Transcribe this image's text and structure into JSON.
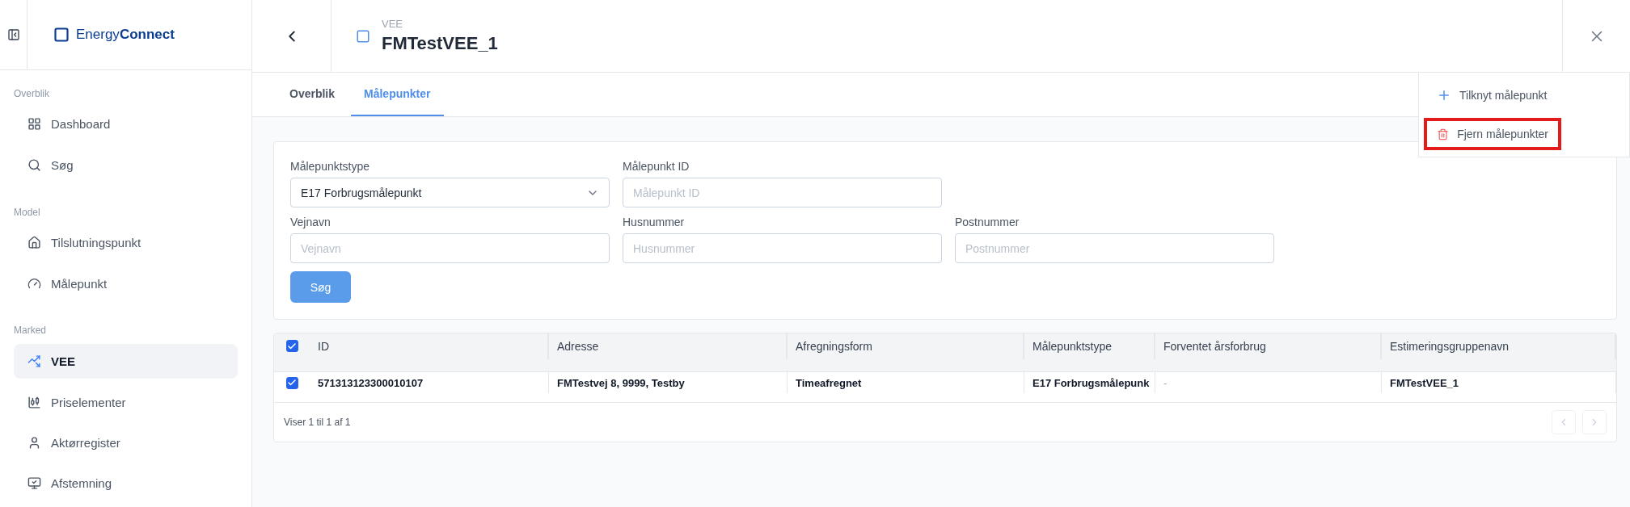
{
  "brand": {
    "light": "Energy",
    "bold": "Connect"
  },
  "sidebar": {
    "sections": [
      {
        "title": "Overblik",
        "items": [
          {
            "label": "Dashboard",
            "selected": false
          },
          {
            "label": "Søg",
            "selected": false
          }
        ]
      },
      {
        "title": "Model",
        "items": [
          {
            "label": "Tilslutningspunkt",
            "selected": false
          },
          {
            "label": "Målepunkt",
            "selected": false
          }
        ]
      },
      {
        "title": "Marked",
        "items": [
          {
            "label": "VEE",
            "selected": true
          },
          {
            "label": "Priselementer",
            "selected": false
          },
          {
            "label": "Aktørregister",
            "selected": false
          },
          {
            "label": "Afstemning",
            "selected": false
          }
        ]
      }
    ]
  },
  "header": {
    "overline": "VEE",
    "title": "FMTestVEE_1"
  },
  "tabs": [
    {
      "label": "Overblik",
      "selected": false
    },
    {
      "label": "Målepunkter",
      "selected": true
    }
  ],
  "menu": [
    {
      "label": "Tilknyt målepunkt",
      "kind": "add",
      "highlighted": false
    },
    {
      "label": "Fjern målepunkter",
      "kind": "delete",
      "highlighted": true
    }
  ],
  "filters": [
    {
      "label": "Målepunktstype",
      "kind": "select",
      "value": "E17 Forbrugsmålepunkt"
    },
    {
      "label": "Målepunkt ID",
      "kind": "text",
      "placeholder": "Målepunkt ID"
    },
    {
      "label": "Vejnavn",
      "kind": "text",
      "placeholder": "Vejnavn"
    },
    {
      "label": "Husnummer",
      "kind": "text",
      "placeholder": "Husnummer"
    },
    {
      "label": "Postnummer",
      "kind": "text",
      "placeholder": "Postnummer"
    }
  ],
  "search_button": "Søg",
  "table": {
    "all_checked": true,
    "columns": [
      "ID",
      "Adresse",
      "Afregningsform",
      "Målepunktstype",
      "Forventet årsforbrug",
      "Estimeringsgruppenavn"
    ],
    "rows": [
      {
        "checked": true,
        "cells": [
          "571313123300010107",
          "FMTestvej 8, 9999, Testby",
          "Timeafregnet",
          "E17 Forbrugsmålepunk",
          "-",
          "FMTestVEE_1"
        ]
      }
    ],
    "footer": "Viser 1 til 1 af 1"
  }
}
